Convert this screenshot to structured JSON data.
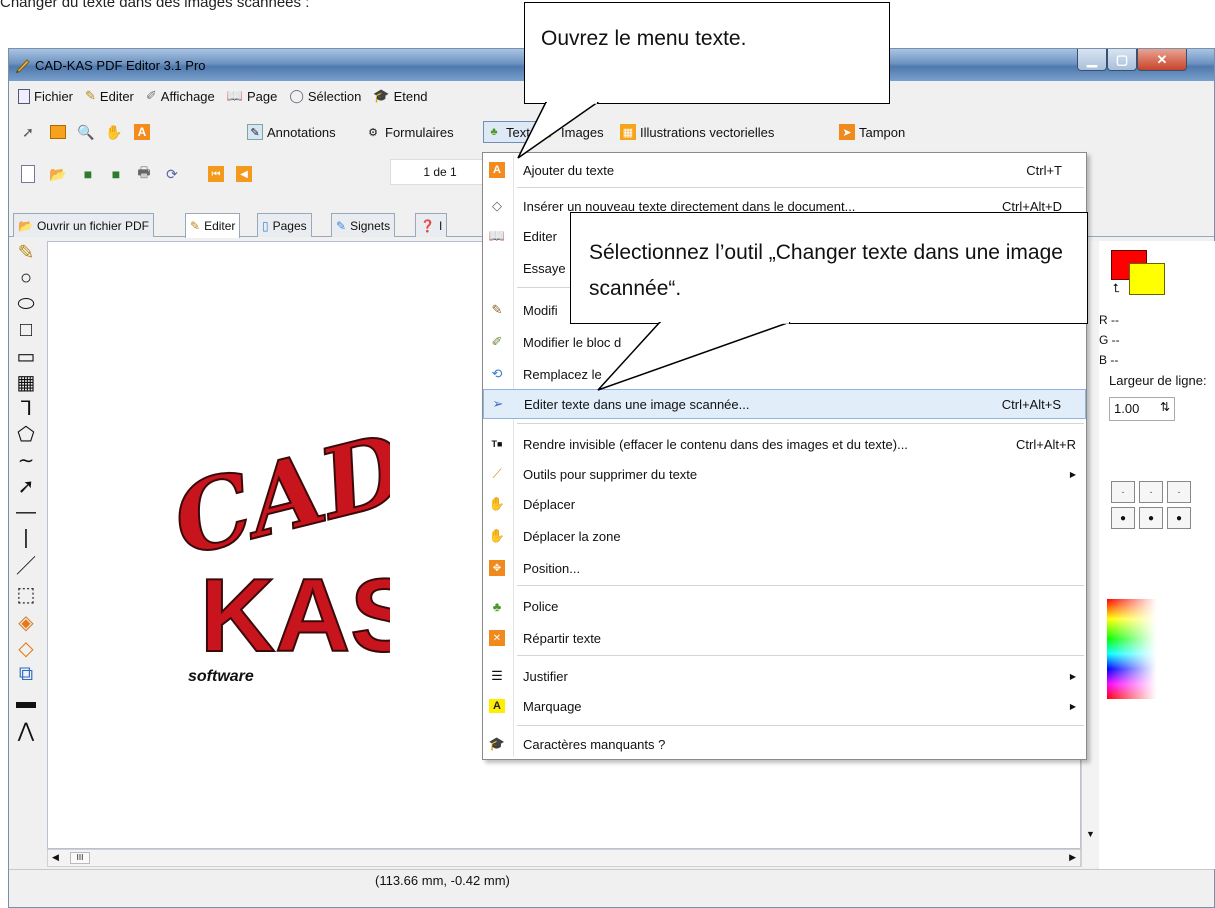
{
  "doc_heading": "Changer du texte dans des images scannées :",
  "window": {
    "title": "CAD-KAS PDF Editor 3.1 Pro"
  },
  "menubar": [
    {
      "label": "Fichier",
      "icon": "file-icon"
    },
    {
      "label": "Editer",
      "icon": "edit-pen-icon"
    },
    {
      "label": "Affichage",
      "icon": "view-icon"
    },
    {
      "label": "Page",
      "icon": "book-icon"
    },
    {
      "label": "Sélection",
      "icon": "lasso-icon"
    },
    {
      "label": "Etend",
      "icon": "hat-icon"
    }
  ],
  "toolbar1": {
    "annotations": "Annotations",
    "formulaires": "Formulaires",
    "texte": "Texte",
    "images": "Images",
    "illustrations": "Illustrations vectorielles",
    "tampon": "Tampon"
  },
  "toolbar2": {
    "page_indicator": "1 de 1"
  },
  "tabs": [
    {
      "label": "Ouvrir un fichier PDF",
      "active": false
    },
    {
      "label": "Editer",
      "active": true
    },
    {
      "label": "Pages",
      "active": false
    },
    {
      "label": "Signets",
      "active": false
    },
    {
      "label": "I",
      "active": false
    }
  ],
  "menu": {
    "items": [
      {
        "label": "Ajouter du texte",
        "shortcut": "Ctrl+T",
        "icon": "add-text-icon",
        "submenu": false
      },
      {
        "label": "Insérer un nouveau texte directement dans le document...",
        "shortcut": "Ctrl+Alt+D",
        "icon": "eraser-icon",
        "submenu": false
      },
      {
        "label": "Editer",
        "shortcut": "",
        "icon": "book-icon",
        "submenu": false
      },
      {
        "label": "Essaye",
        "shortcut": "",
        "icon": "",
        "submenu": false
      },
      {
        "label": "Modifi",
        "shortcut": "",
        "icon": "pen-icon",
        "submenu": false
      },
      {
        "label": "Modifier le bloc d",
        "shortcut": "",
        "icon": "edit-block-icon",
        "submenu": false
      },
      {
        "label": "Remplacez le",
        "shortcut": "",
        "icon": "replace-icon",
        "submenu": false
      },
      {
        "label": "Editer texte dans une image scannée...",
        "shortcut": "Ctrl+Alt+S",
        "icon": "scanner-icon",
        "submenu": false
      },
      {
        "label": "Rendre invisible (effacer le contenu dans des images et du texte)...",
        "shortcut": "Ctrl+Alt+R",
        "icon": "redact-icon",
        "submenu": false
      },
      {
        "label": "Outils pour supprimer du texte",
        "shortcut": "",
        "icon": "broom-icon",
        "submenu": true
      },
      {
        "label": "Déplacer",
        "shortcut": "",
        "icon": "hand-icon",
        "submenu": false
      },
      {
        "label": "Déplacer la zone",
        "shortcut": "",
        "icon": "hand-zone-icon",
        "submenu": false
      },
      {
        "label": "Position...",
        "shortcut": "",
        "icon": "position-icon",
        "submenu": false
      },
      {
        "label": "Police",
        "shortcut": "",
        "icon": "font-icon",
        "submenu": false
      },
      {
        "label": "Répartir texte",
        "shortcut": "",
        "icon": "distribute-icon",
        "submenu": false
      },
      {
        "label": "Justifier",
        "shortcut": "",
        "icon": "justify-icon",
        "submenu": true
      },
      {
        "label": "Marquage",
        "shortcut": "",
        "icon": "highlight-icon",
        "submenu": true
      },
      {
        "label": "Caractères manquants ?",
        "shortcut": "",
        "icon": "hat-icon",
        "submenu": false
      }
    ]
  },
  "callouts": {
    "open_menu": "Ouvrez le menu texte.",
    "select_tool": "Sélectionnez l’outil „Changer texte dans une image scannée“."
  },
  "right_panel": {
    "r": "R --",
    "g": "G --",
    "b": "B --",
    "line_width_label": "Largeur de ligne:",
    "line_width_value": "1.00",
    "colors": {
      "primary": "#ff0000",
      "secondary": "#ffff00"
    }
  },
  "logo": {
    "line1": "CAD",
    "line2": "KAS",
    "tagline": "software"
  },
  "status": {
    "coords": "(113.66 mm, -0.42 mm)"
  }
}
